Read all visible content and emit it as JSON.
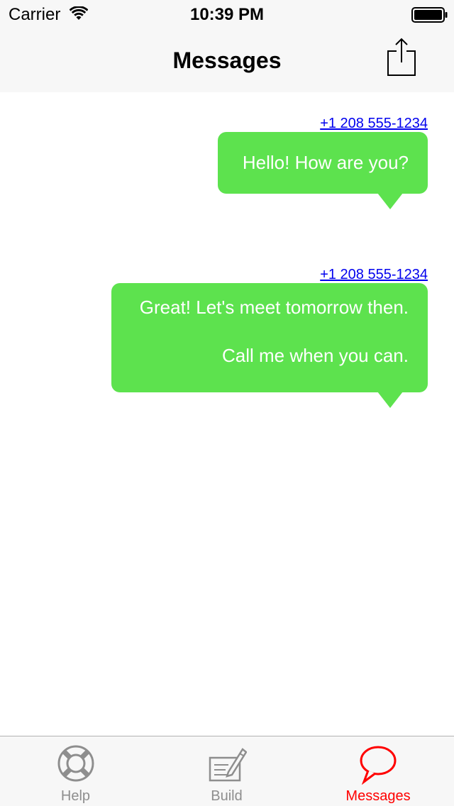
{
  "status_bar": {
    "carrier": "Carrier",
    "time": "10:39 PM",
    "wifi_icon": "wifi-icon",
    "battery_icon": "battery-icon"
  },
  "nav_bar": {
    "title": "Messages",
    "share_icon": "share-icon"
  },
  "messages": [
    {
      "sender": "+1 208 555-1234",
      "lines": [
        "Hello! How are you?"
      ]
    },
    {
      "sender": "+1 208 555-1234",
      "lines": [
        "Great! Let's meet tomorrow then.",
        "Call me when you can."
      ]
    }
  ],
  "tab_bar": {
    "tabs": [
      {
        "label": "Help",
        "icon": "lifebuoy-icon",
        "selected": false
      },
      {
        "label": "Build",
        "icon": "compose-icon",
        "selected": false
      },
      {
        "label": "Messages",
        "icon": "speech-bubble-icon",
        "selected": true
      }
    ]
  },
  "colors": {
    "bubble": "#5de24e",
    "bubble_text": "#ffffff",
    "link": "#0000ee",
    "tab_selected": "#ff0000",
    "tab_unselected": "#8e8e8e",
    "bar_background": "#f7f7f7"
  }
}
